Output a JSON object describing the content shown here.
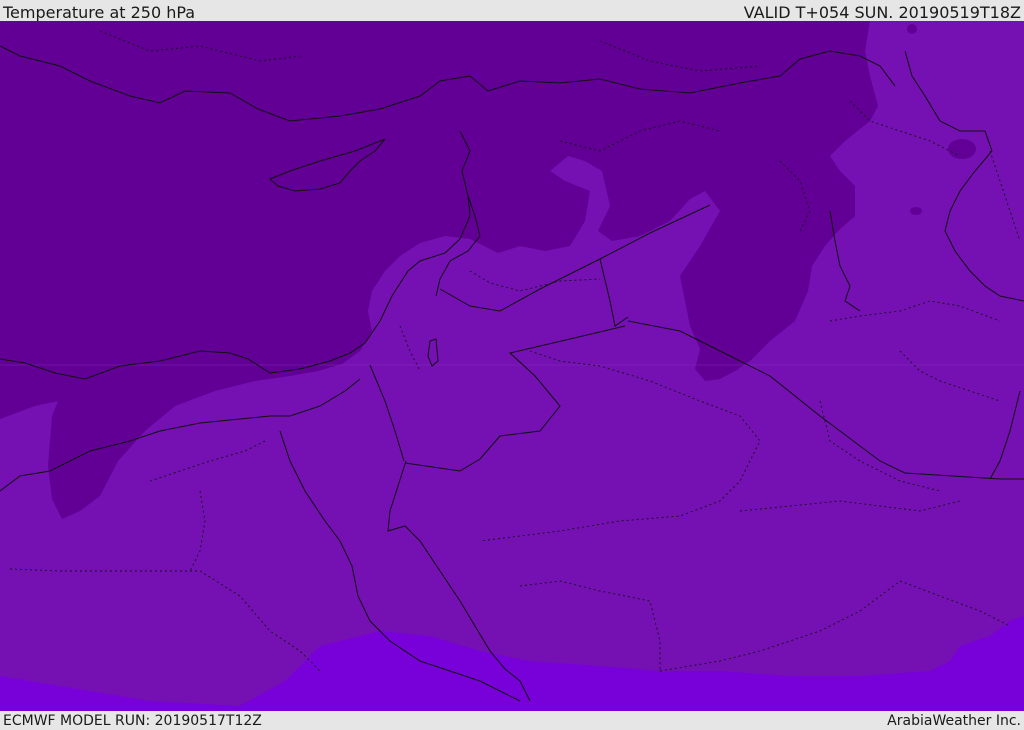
{
  "header": {
    "title": "Temperature at 250 hPa",
    "valid_time": "VALID T+054 SUN. 20190519T18Z"
  },
  "footer": {
    "model_run": "ECMWF MODEL RUN: 20190517T12Z",
    "credit": "ArabiaWeather Inc."
  },
  "map": {
    "colors": {
      "coldest_band": "#620096",
      "middle_band": "#7510b3",
      "warmer_band": "#7800d8",
      "coastline": "#111111",
      "borders": "#111111"
    }
  }
}
